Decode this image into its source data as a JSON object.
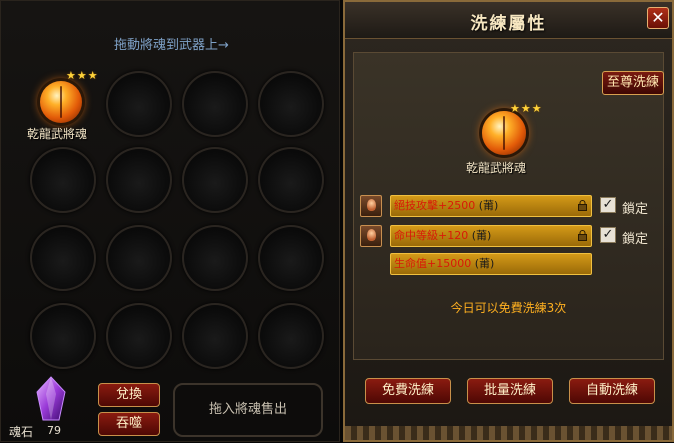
{
  "left_panel": {
    "hint": "拖動將魂到武器上→",
    "equipped_soul": {
      "name": "乾龍武將魂",
      "stars": 3
    },
    "soul_stone": {
      "label": "魂石",
      "count": "79"
    },
    "buttons": {
      "exchange": "兌換",
      "devour": "吞噬"
    },
    "sell_area": "拖入將魂售出"
  },
  "refine_dialog": {
    "title": "洗練屬性",
    "close_symbol": "✕",
    "supreme_refine": "至尊洗練",
    "soul": {
      "name": "乾龍武將魂",
      "stars": 3
    },
    "attributes": [
      {
        "name": "絕技攻擊+2500",
        "quality": "(莆)",
        "locked": true,
        "lock_label": "鎖定"
      },
      {
        "name": "命中等級+120",
        "quality": "(莆)",
        "locked": true,
        "lock_label": "鎖定"
      },
      {
        "name": "生命值+15000",
        "quality": "(莆)",
        "locked": false
      }
    ],
    "free_refine_info": "今日可以免費洗練3次",
    "buttons": {
      "free": "免費洗練",
      "batch": "批量洗練",
      "auto": "自動洗練"
    }
  },
  "colors": {
    "gold": "#d49a18",
    "red": "#d81a08",
    "orange_text": "#ffb020"
  }
}
